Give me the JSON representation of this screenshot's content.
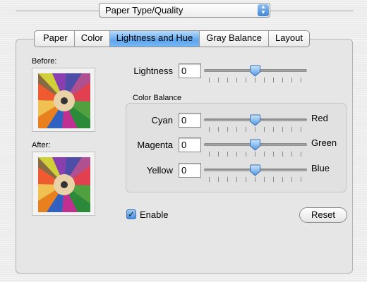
{
  "popup": {
    "value": "Paper Type/Quality"
  },
  "tabs": [
    {
      "label": "Paper",
      "selected": false
    },
    {
      "label": "Color",
      "selected": false
    },
    {
      "label": "Lightness and Hue",
      "selected": true
    },
    {
      "label": "Gray Balance",
      "selected": false
    },
    {
      "label": "Layout",
      "selected": false
    }
  ],
  "preview": {
    "before_label": "Before:",
    "after_label": "After:"
  },
  "lightness": {
    "label": "Lightness",
    "value": "0"
  },
  "color_balance": {
    "title": "Color Balance",
    "rows": [
      {
        "label": "Cyan",
        "value": "0",
        "end_label": "Red"
      },
      {
        "label": "Magenta",
        "value": "0",
        "end_label": "Green"
      },
      {
        "label": "Yellow",
        "value": "0",
        "end_label": "Blue"
      }
    ]
  },
  "enable": {
    "label": "Enable",
    "checked": true
  },
  "reset": {
    "label": "Reset"
  },
  "colors": {
    "accent": "#5fa6ee",
    "panel": "#e6e6e6"
  }
}
